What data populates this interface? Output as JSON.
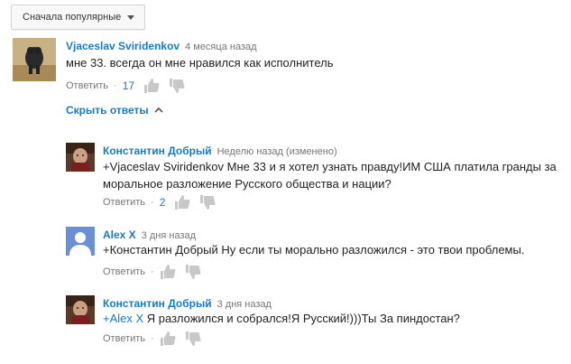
{
  "sort": {
    "label": "Сначала популярные"
  },
  "top_comment": {
    "author": "Vjaceslav Sviridenkov",
    "time": "4 месяца назад",
    "text": "мне 33. всегда он мне нравился как исполнитель",
    "reply_label": "Ответить",
    "likes": "17"
  },
  "hide_replies": {
    "label": "Скрыть ответы"
  },
  "replies": [
    {
      "author": "Константин Добрый",
      "time": "Неделю назад (изменено)",
      "mention": "+Vjaceslav Sviridenkov",
      "text": " Мне 33 и я хотел узнать правду!ИМ США платила гранды за моральное разложение Русского общества и нации?",
      "reply_label": "Ответить",
      "likes": "2"
    },
    {
      "author": "Alex X",
      "time": "3 дня назад",
      "text": "+Константин Добрый Ну если ты морально разложился - это твои проблемы.",
      "reply_label": "Ответить"
    },
    {
      "author": "Константин Добрый",
      "time": "3 дня назад",
      "mention": "+Alex X",
      "text": " Я разложился и собрался!Я Русский!)))Ты За пиндостан?",
      "reply_label": "Ответить"
    }
  ],
  "colors": {
    "link": "#167ac6",
    "meta": "#767676",
    "avatar_blue": "#6b8fd6"
  }
}
